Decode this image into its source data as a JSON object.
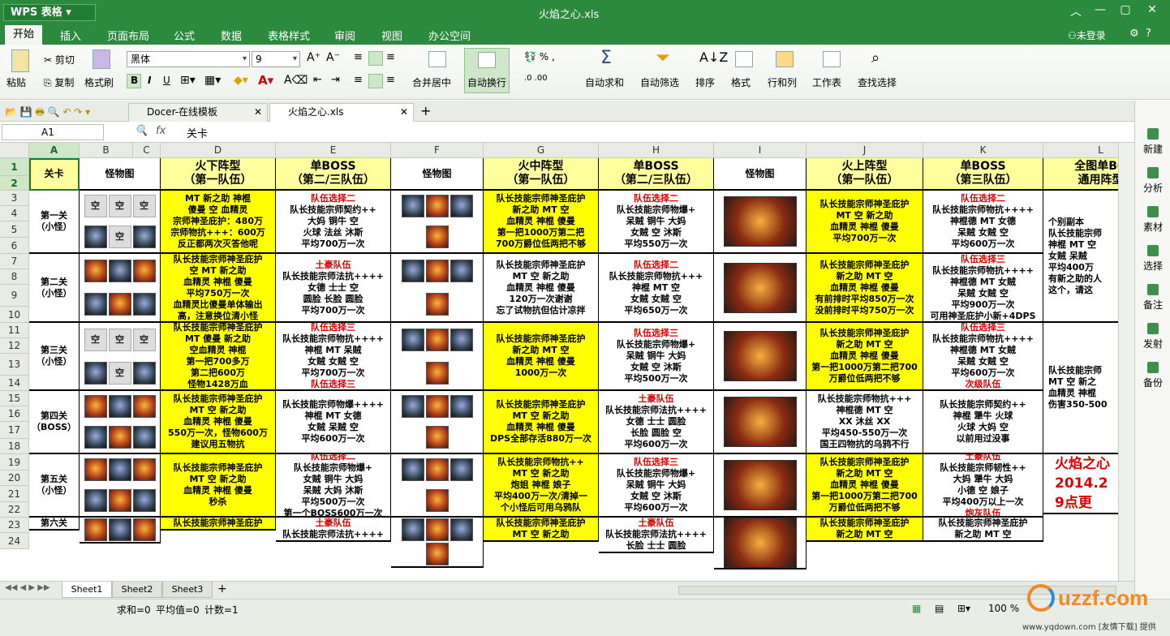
{
  "app": {
    "name": "WPS 表格",
    "doc_title": "火焰之心.xls",
    "login": "未登录"
  },
  "menu": [
    "开始",
    "插入",
    "页面布局",
    "公式",
    "数据",
    "表格样式",
    "审阅",
    "视图",
    "办公空间"
  ],
  "ribbon": {
    "paste": "粘贴",
    "cut": "剪切",
    "copy": "复制",
    "format_painter": "格式刷",
    "font": "黑体",
    "size": "9",
    "merge_center": "合并居中",
    "wrap": "自动换行",
    "autosum": "自动求和",
    "autofilter": "自动筛选",
    "sort": "排序",
    "format": "格式",
    "rowcol": "行和列",
    "worksheet": "工作表",
    "findselect": "查找选择"
  },
  "doc_tabs": [
    {
      "label": "Docer-在线模板"
    },
    {
      "label": "火焰之心.xls"
    }
  ],
  "formula_bar": {
    "cell_ref": "A1",
    "content": "关卡"
  },
  "columns": [
    "A",
    "B",
    "C",
    "D",
    "E",
    "F",
    "G",
    "H",
    "I",
    "J",
    "K",
    "L"
  ],
  "rows": [
    "1",
    "2",
    "3",
    "4",
    "5",
    "6",
    "7",
    "8",
    "9",
    "10",
    "11",
    "12",
    "13",
    "14",
    "15",
    "16",
    "17",
    "18",
    "19",
    "20",
    "21",
    "22",
    "23",
    "24"
  ],
  "headers": {
    "a": "关卡",
    "b": "怪物图",
    "d": [
      "火下阵型",
      "（第一队伍）"
    ],
    "e": [
      "单BOSS",
      "（第二/三队伍）"
    ],
    "f": "怪物图",
    "g": [
      "火中阵型",
      "（第一队伍）"
    ],
    "h": [
      "单BOSS",
      "（第二/三队伍）"
    ],
    "i": "怪物图",
    "j": [
      "火上阵型",
      "（第一队伍）"
    ],
    "k": [
      "单BOSS",
      "（第三队伍）"
    ],
    "l": [
      "全图单BO",
      "通用阵型"
    ]
  },
  "stages": [
    {
      "name": [
        "第一关",
        "（小怪）"
      ],
      "d": [
        "MT 新之助 神棍",
        "傻曼 空 血精灵",
        "宗师神圣庇护：480万",
        "宗师物抗+++：600万",
        "反正都两次灭答他呢"
      ],
      "e": [
        {
          "t": "队伍选择二",
          "r": true
        },
        {
          "t": "队长技能宗师契约++"
        },
        {
          "t": "大妈 铜牛 空"
        },
        {
          "t": "火球 法丝 沐斯"
        },
        {
          "t": "平均700万一次"
        }
      ],
      "g": [
        "队长技能宗师神圣庇护",
        "新之助 MT 空",
        "血精灵 神棍 傻曼",
        "第一把1000万第二把",
        "700万爵位低两把不够"
      ],
      "h": [
        {
          "t": "队伍选择二",
          "r": true
        },
        {
          "t": "队长技能宗师物爆+"
        },
        {
          "t": "呆贼 铜牛 大妈"
        },
        {
          "t": "女贼 空 沐斯"
        },
        {
          "t": "平均550万一次"
        }
      ],
      "j": [
        "队长技能宗师神圣庇护",
        "MT 空 新之助",
        "血精灵 神棍 傻曼",
        "平均700万一次"
      ],
      "k": [
        {
          "t": "队伍选择二",
          "r": true
        },
        {
          "t": "队长技能宗师物抗++++"
        },
        {
          "t": "神棍德 MT 女德"
        },
        {
          "t": "呆贼 女贼 空"
        },
        {
          "t": "平均600万一次"
        }
      ],
      "l": [
        "",
        "个别副本",
        "队长技能宗师",
        "神棍 MT 空",
        "女贼 呆贼",
        "平均400万",
        "有新之助的人",
        "这个，请这"
      ]
    },
    {
      "name": [
        "第二关",
        "（小怪）"
      ],
      "d": [
        "队长技能宗师神圣庇护",
        "空 MT 新之助",
        "血精灵 神棍 傻曼",
        "平均750万一次",
        "血精灵比傻曼单体输出",
        "高，注意换位清小怪"
      ],
      "e": [
        {
          "t": "土豪队伍",
          "r": true
        },
        {
          "t": "队长技能宗师法抗++++"
        },
        {
          "t": "女德 士士 空"
        },
        {
          "t": "圆脸 长脸 圆脸"
        },
        {
          "t": "平均700万一次"
        }
      ],
      "g": [
        "队长技能宗师神圣庇护",
        "MT 空 新之助",
        "血精灵 神棍 傻曼",
        "120万一次谢谢",
        "忘了试物抗但估计凉拌"
      ],
      "h": [
        {
          "t": "队伍选择二",
          "r": true
        },
        {
          "t": "队长技能宗师物抗+++"
        },
        {
          "t": "神棍 MT 空"
        },
        {
          "t": "女贼 女贼 空"
        },
        {
          "t": "平均650万一次"
        }
      ],
      "j": [
        "队长技能宗师神圣庇护",
        "新之助 MT 空",
        "血精灵 神棍 傻曼",
        "有前排时平均850万一次",
        "没前排时平均750万一次"
      ],
      "k": [
        {
          "t": "队伍选择三",
          "r": true
        },
        {
          "t": "队长技能宗师物抗++++"
        },
        {
          "t": "神棍德 MT 女贼"
        },
        {
          "t": "呆贼 女贼 空"
        },
        {
          "t": "平均900万一次"
        },
        {
          "t": "可用神圣庇护小新+4DPS"
        }
      ]
    },
    {
      "name": [
        "第三关",
        "（小怪）"
      ],
      "d": [
        "队长技能宗师神圣庇护",
        "MT 傻曼 新之助",
        "空血精灵 神棍",
        "第一把700多万",
        "第二把600万",
        "怪物1428万血"
      ],
      "e": [
        {
          "t": "队伍选择三",
          "r": true
        },
        {
          "t": "队长技能宗师物抗++++"
        },
        {
          "t": "神棍 MT 呆贼"
        },
        {
          "t": "女贼 女贼 空"
        },
        {
          "t": "平均700万一次"
        },
        {
          "t": "队伍选择三",
          "r": true
        }
      ],
      "g": [
        "队长技能宗师神圣庇护",
        "新之助 MT 空",
        "血精灵 神棍 傻曼",
        "1000万一次"
      ],
      "h": [
        {
          "t": "队伍选择三",
          "r": true
        },
        {
          "t": "队长技能宗师物爆+"
        },
        {
          "t": "呆贼 铜牛 大妈"
        },
        {
          "t": "女贼 空 沐斯"
        },
        {
          "t": "平均500万一次"
        }
      ],
      "j": [
        "队长技能宗师神圣庇护",
        "新之助 MT 空",
        "血精灵 神棍 傻曼",
        "第一把1000万第二把700",
        "万爵位低两把不够"
      ],
      "k": [
        {
          "t": "队伍选择三",
          "r": true
        },
        {
          "t": "队长技能宗师物抗++++"
        },
        {
          "t": "神棍德 MT 女贼"
        },
        {
          "t": "呆贼 女贼 空"
        },
        {
          "t": "平均600万一次"
        },
        {
          "t": "次级队伍",
          "r": true
        }
      ],
      "l": [
        "",
        "队长技能宗师",
        "MT 空 新之",
        "血精灵 神棍",
        "伤害350-500"
      ]
    },
    {
      "name": [
        "第四关",
        "（BOSS）"
      ],
      "d": [
        "队长技能宗师神圣庇护",
        "MT 空 新之助",
        "血精灵 神棍 傻曼",
        "550万一次，怪物600万",
        "建议用五物抗"
      ],
      "e": [
        {
          "t": "队长技能宗师物爆++++"
        },
        {
          "t": "神棍 MT 女德"
        },
        {
          "t": "女贼 呆贼 空"
        },
        {
          "t": "平均600万一次"
        }
      ],
      "g": [
        "队长技能宗师神圣庇护",
        "MT 空 新之助",
        "血精灵 神棍 傻曼",
        "DPS全部存活880万一次"
      ],
      "h": [
        {
          "t": "土豪队伍",
          "r": true
        },
        {
          "t": "队长技能宗师法抗++++"
        },
        {
          "t": "女德 士士 圆脸"
        },
        {
          "t": "长脸 圆脸 空"
        },
        {
          "t": "平均600万一次"
        }
      ],
      "j": [
        "队长技能宗师物抗+++",
        "神棍德 MT 空",
        "XX 沐丝 XX",
        "平均450-550万一次",
        "国王四物抗的乌鸦不行"
      ],
      "k": [
        {
          "t": "队长技能宗师契约++"
        },
        {
          "t": "神棍 犟牛 火球"
        },
        {
          "t": "火球 大妈 空"
        },
        {
          "t": "以前用过没事"
        }
      ]
    },
    {
      "name": [
        "第五关",
        "（小怪）"
      ],
      "d": [
        "队长技能宗师神圣庇护",
        "MT 空 新之助",
        "血精灵 神棍 傻曼",
        "秒杀"
      ],
      "e": [
        {
          "t": "队伍选择二",
          "r": true
        },
        {
          "t": "队长技能宗师物爆+"
        },
        {
          "t": "女贼 铜牛 大妈"
        },
        {
          "t": "呆贼 大妈 沐斯"
        },
        {
          "t": "平均500万一次"
        },
        {
          "t": "第一个BOSS600万一次"
        }
      ],
      "g": [
        "队长技能宗师物抗++",
        "MT 空 新之助",
        "炮姐 神棍 娘子",
        "平均400万一次/清掉一",
        "个小怪后可用乌鸦队"
      ],
      "h": [
        {
          "t": "队伍选择三",
          "r": true
        },
        {
          "t": "队长技能宗师物爆+"
        },
        {
          "t": "呆贼 铜牛 大妈"
        },
        {
          "t": "女贼 空 沐斯"
        },
        {
          "t": "平均600万一次"
        }
      ],
      "j": [
        "队长技能宗师神圣庇护",
        "新之助 MT 空",
        "血精灵 神棍 傻曼",
        "第一把1000万第二把700",
        "万爵位低两把不够"
      ],
      "k": [
        {
          "t": "土豪队伍",
          "r": true
        },
        {
          "t": "队长技能宗师韧性++"
        },
        {
          "t": "大妈 犟牛 大妈"
        },
        {
          "t": "小德 空 娘子"
        },
        {
          "t": "平均400万以上一次"
        },
        {
          "t": "炮灰队伍",
          "r": true
        }
      ],
      "l": [
        "火焰之心",
        "2014.2",
        "9点更"
      ]
    },
    {
      "name": [
        "第六关"
      ],
      "d": [
        "队长技能宗师神圣庇护"
      ],
      "e": [
        {
          "t": "土豪队伍",
          "r": true
        },
        {
          "t": "队长技能宗师法抗++++"
        }
      ],
      "g": [
        "队长技能宗师神圣庇护",
        "MT 空 新之助"
      ],
      "h": [
        {
          "t": "土豪队伍",
          "r": true
        },
        {
          "t": "队长技能宗师法抗++++"
        },
        {
          "t": "长脸 士士 圆脸"
        }
      ],
      "j": [
        "队长技能宗师神圣庇护",
        "新之助 MT 空"
      ],
      "k": [
        {
          "t": "队长技能宗师神圣庇护"
        },
        {
          "t": "新之助 MT 空"
        }
      ]
    }
  ],
  "empty_label": "空",
  "sheet_tabs": [
    "Sheet1",
    "Sheet2",
    "Sheet3"
  ],
  "status": {
    "sum": "求和=0",
    "avg": "平均值=0",
    "count": "计数=1",
    "zoom": "100 %"
  },
  "side_panel": [
    "新建",
    "分析",
    "素材",
    "选择",
    "备注",
    "发射",
    "备份"
  ],
  "watermark": {
    "brand": "uzzf.com",
    "sub": "www.yqdown.com [友情下载] 提供"
  },
  "colors": {
    "title_green": "#2b8a3e",
    "header_yellow": "#ffff9e",
    "cell_yellow": "#ffff00",
    "accent_red": "#dd0000"
  }
}
